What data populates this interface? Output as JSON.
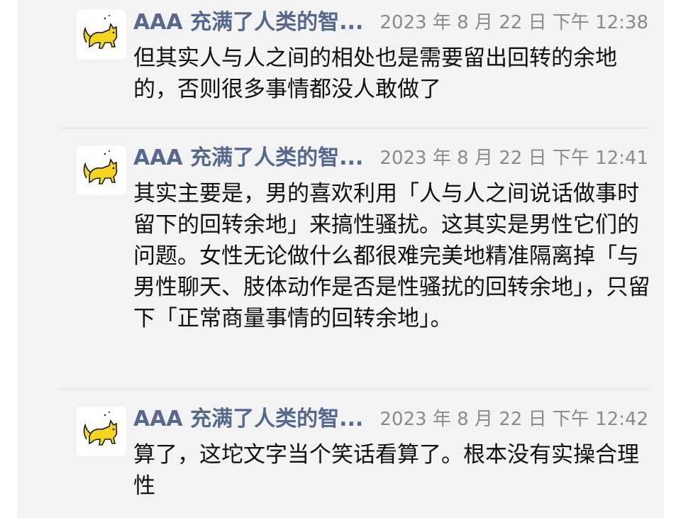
{
  "messages": [
    {
      "sender": "AAA 充满了人类的智...",
      "time": "2023 年 8 月 22 日 下午 12:38",
      "text": "但其实人与人之间的相处也是需要留出回转的余地的，否则很多事情都没人敢做了"
    },
    {
      "sender": "AAA 充满了人类的智...",
      "time": "2023 年 8 月 22 日 下午 12:41",
      "text": "其实主要是，男的喜欢利用「人与人之间说话做事时留下的回转余地」来搞性骚扰。这其实是男性它们的问题。女性无论做什么都很难完美地精准隔离掉「与男性聊天、肢体动作是否是性骚扰的回转余地」，只留下「正常商量事情的回转余地」。"
    },
    {
      "sender": "AAA 充满了人类的智...",
      "time": "2023 年 8 月 22 日 下午 12:42",
      "text": "算了，这坨文字当个笑话看算了。根本没有实操合理性"
    }
  ],
  "colors": {
    "sender": "#56688e",
    "time": "#8b8b8b",
    "text": "#111111",
    "background": "#f3f3f3"
  },
  "icons": {
    "avatar": "yellow-cat-icon"
  }
}
